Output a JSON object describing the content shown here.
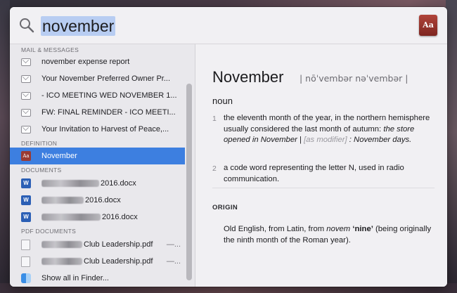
{
  "search": {
    "query": "november"
  },
  "sections": {
    "mail": "MAIL & MESSAGES",
    "definition": "DEFINITION",
    "documents": "DOCUMENTS",
    "pdf": "PDF DOCUMENTS"
  },
  "mail_items": [
    "november expense report",
    "Your November Preferred Owner Pr...",
    "- ICO MEETING WED NOVEMBER 1...",
    "FW: FINAL REMINDER - ICO MEETI...",
    "Your Invitation to Harvest of Peace,..."
  ],
  "definition_item": "November",
  "documents": [
    "2016.docx",
    "2016.docx",
    "2016.docx"
  ],
  "pdfs": [
    {
      "name": "Club Leadership.pdf",
      "trail": "—..."
    },
    {
      "name": "Club Leadership.pdf",
      "trail": "—..."
    }
  ],
  "show_all": "Show all in Finder...",
  "dictionary": {
    "headword": "November",
    "pronunciation": "| nōˈvembər    nəˈvembər |",
    "part_of_speech": "noun",
    "def1_num": "1",
    "def1_text": "the eleventh month of the year, in the northern hemisphere usually considered the last month of autumn:",
    "def1_example": "the store opened in November",
    "def1_sep": "|",
    "def1_as": "[as modifier]",
    "def1_example2": ": November days.",
    "def2_num": "2",
    "def2_text": "a code word representing the letter N, used in radio communication.",
    "origin_heading": "ORIGIN",
    "origin_pre": "Old English, from Latin, from",
    "origin_word": "novem",
    "origin_gloss": "‘nine’",
    "origin_post": "(being originally the ninth month of the Roman year)."
  },
  "colors": {
    "selection": "#3d7fe0",
    "query_highlight": "#b8cdf2"
  }
}
